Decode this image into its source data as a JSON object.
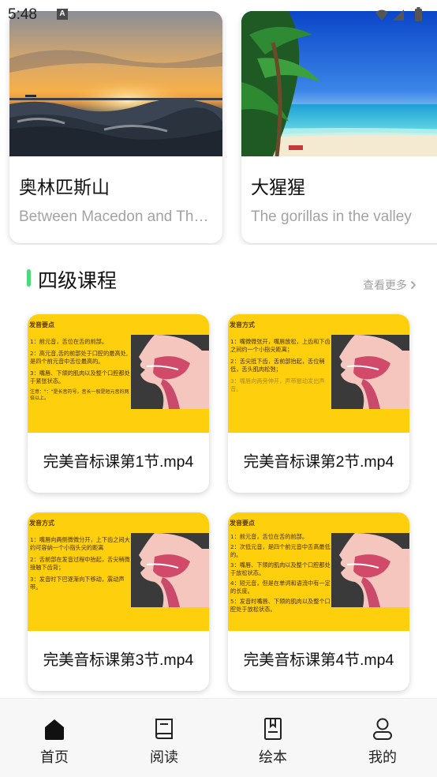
{
  "status_bar": {
    "time": "5:48",
    "notification_icon": "A"
  },
  "featured": [
    {
      "title": "奥林匹斯山",
      "subtitle": "Between Macedon and Thessaly",
      "image": "sunset-sea-photo"
    },
    {
      "title": "大猩猩",
      "subtitle": "The gorillas in the valley",
      "image": "tropical-beach-photo"
    }
  ],
  "section": {
    "title": "四级课程",
    "more_label": "查看更多"
  },
  "courses": [
    {
      "title": "完美音标课第1节.mp4",
      "thumb_heading": "发音要点",
      "thumb_lines": [
        "1：前元音，舌位在舌的前部。",
        "2：高元音,舌的前部处于口腔的最高处,是四个前元音中舌位最高的。",
        "3：嘴唇、下颌的肌肉以及整个口腔都处于紧张状态。"
      ],
      "thumb_note": "注意：\"：\"是长音符号，音长一般是短元音的两倍以上。"
    },
    {
      "title": "完美音标课第2节.mp4",
      "thumb_heading": "发音方式",
      "thumb_lines": [
        "1：嘴微微张开，嘴唇放松，上齿和下齿之间约一个小指尖距离；",
        "2：舌尖抵下齿，舌前部抬起，舌位稍低，舌头肌肉松弛；",
        "3：嘴唇向两旁伸开，声带振动发出声音。"
      ],
      "thumb_note": ""
    },
    {
      "title": "完美音标课第3节.mp4",
      "thumb_heading": "发音方式",
      "thumb_lines": [
        "1：嘴唇向两侧微微分开，上下齿之间大约可容纳一个小指头尖的距离",
        "2：舌前部在发音过程中抬起，舌尖稍微接触下齿背；",
        "3：发音时下巴逐渐向下移动，震动声带。"
      ],
      "thumb_note": ""
    },
    {
      "title": "完美音标课第4节.mp4",
      "thumb_heading": "发音要点",
      "thumb_lines": [
        "1：前元音，舌位在舌的前部。",
        "2：次低元音，是四个前元音中舌高最低的。",
        "3：嘴唇、下颌的肌肉以及整个口腔都处于放松状态。",
        "4：短元音，但是在单词和语流中有一定的长度。",
        "5：发音时嘴唇、下颌的肌肉以及整个口腔处于放松状态。"
      ],
      "thumb_note": ""
    }
  ],
  "tabs": [
    {
      "label": "首页",
      "icon": "home-icon",
      "active": true
    },
    {
      "label": "阅读",
      "icon": "book-icon",
      "active": false
    },
    {
      "label": "绘本",
      "icon": "picture-book-icon",
      "active": false
    },
    {
      "label": "我的",
      "icon": "user-icon",
      "active": false
    }
  ],
  "colors": {
    "accent": "#4cd97b",
    "thumb_bg": "#fecf0c",
    "muted_text": "#a3a3a3"
  }
}
